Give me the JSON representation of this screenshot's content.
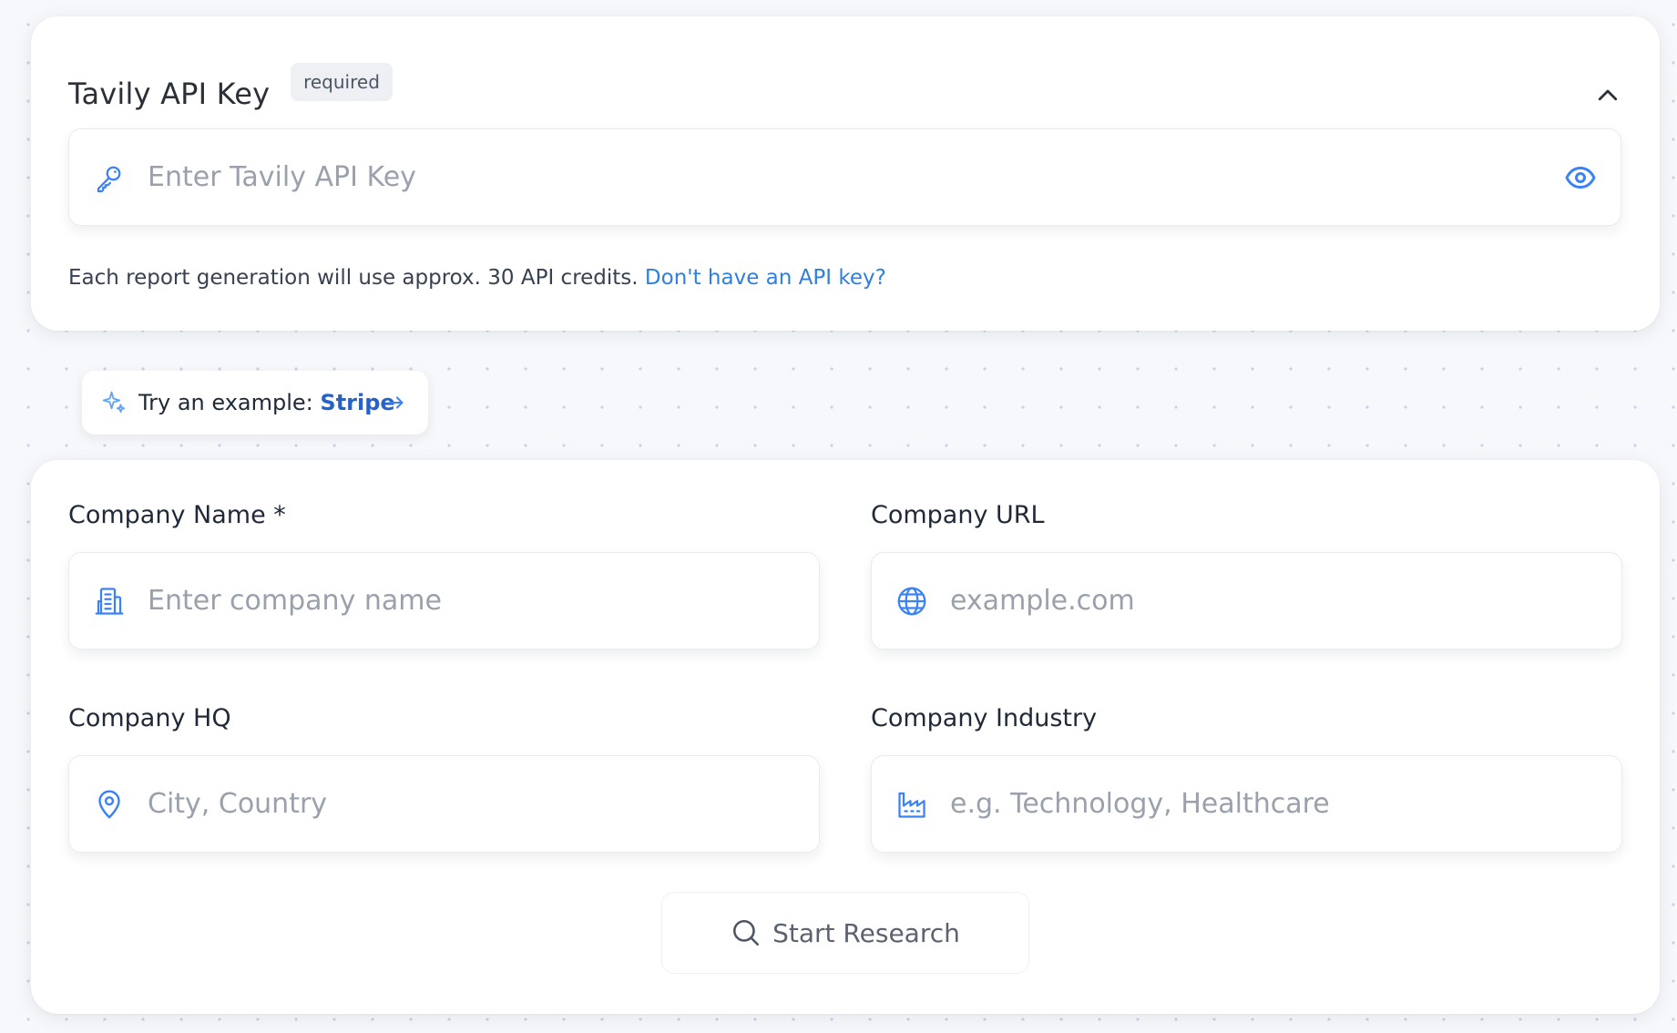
{
  "api_key_card": {
    "title": "Tavily API Key",
    "badge": "required",
    "input_placeholder": "Enter Tavily API Key",
    "note": "Each report generation will use approx. 30 API credits.",
    "link": "Don't have an API key?"
  },
  "example": {
    "prefix": "Try an example:",
    "company": "Stripe"
  },
  "form": {
    "company_name": {
      "label": "Company Name *",
      "placeholder": "Enter company name"
    },
    "company_url": {
      "label": "Company URL",
      "placeholder": "example.com"
    },
    "company_hq": {
      "label": "Company HQ",
      "placeholder": "City, Country"
    },
    "company_industry": {
      "label": "Company Industry",
      "placeholder": "e.g. Technology, Healthcare"
    },
    "submit_label": "Start Research"
  },
  "icons": {
    "key": "key-icon",
    "eye": "eye-icon",
    "chevron": "chevron-up-icon",
    "sparkle": "sparkles-icon",
    "arrow": "arrow-right-icon",
    "building": "building-icon",
    "globe": "globe-icon",
    "pin": "map-pin-icon",
    "factory": "factory-icon",
    "search": "search-icon"
  },
  "colors": {
    "accent": "#2f7fe0",
    "icon_blue": "#3b82f6",
    "link": "#2f7fe0",
    "background": "#f7f8fb"
  }
}
